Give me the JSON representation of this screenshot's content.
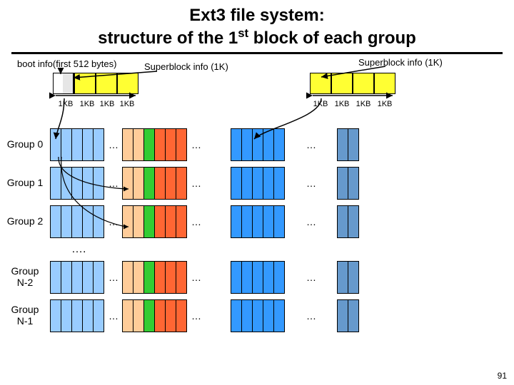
{
  "title_line1": "Ext3 file system:",
  "title_line2_pre": "structure of the 1",
  "title_line2_sup": "st",
  "title_line2_post": " block of each group",
  "boot_label": "boot info(first 512 bytes)",
  "sb_label": "Superblock info (1K)",
  "size_label": "1KB",
  "size_label2": "1KB",
  "ellipsis": "…",
  "vdots": "….",
  "groups": {
    "g0": "Group 0",
    "g1": "Group 1",
    "g2": "Group 2",
    "gn2a": "Group",
    "gn2b": "N-2",
    "gn1a": "Group",
    "gn1b": "N-1"
  },
  "page": "91",
  "chart_data": {
    "type": "table",
    "title": "Ext3 file system: structure of the 1st block of each group",
    "notes": [
      "boot info occupies first 512 bytes of the first 1KB block (Group 0 only)",
      "Superblock info occupies 1K; groups contain repeating 1KB blocks"
    ],
    "top_detail_left": {
      "block_count": 4,
      "block_size": "1KB",
      "block0_split": [
        "boot 512B",
        "superblock 512B"
      ],
      "remaining_blocks_color": "yellow"
    },
    "top_detail_right": {
      "block_count": 4,
      "block_size": "1KB",
      "all_blocks_color": "yellow",
      "label": "Superblock info (1K)"
    },
    "rows": [
      {
        "label": "Group 0",
        "segments": 5
      },
      {
        "label": "Group 1",
        "segments": 5
      },
      {
        "label": "Group 2",
        "segments": 5
      },
      {
        "label": "Group N-2",
        "segments": 5
      },
      {
        "label": "Group N-1",
        "segments": 5
      }
    ],
    "segment_pattern": [
      "light-blue x5",
      "ellipsis",
      "peach x2 + green x1 + orange x3",
      "ellipsis",
      "medium-blue x5",
      "ellipsis",
      "steel-blue x2"
    ]
  }
}
